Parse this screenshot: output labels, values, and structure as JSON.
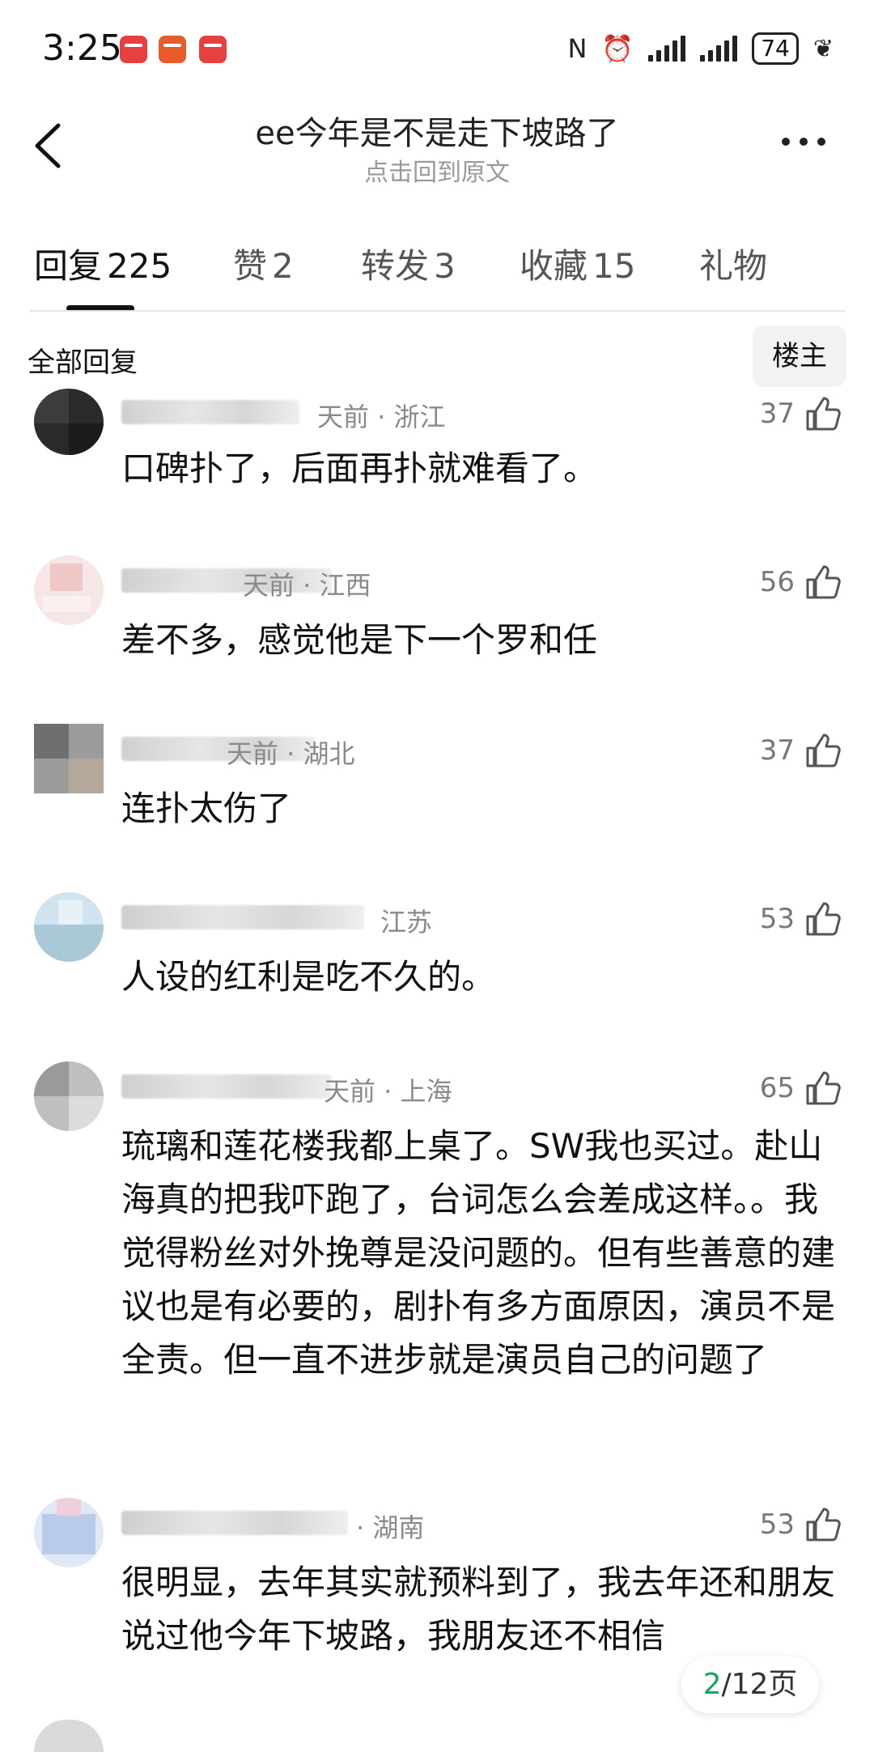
{
  "status_bar": {
    "time": "3:25",
    "battery": "74",
    "nfc_icon": "N",
    "alarm_icon": "⏰",
    "leaf_icon": "❦"
  },
  "header": {
    "title": "ee今年是不是走下坡路了",
    "subtitle": "点击回到原文"
  },
  "tabs": [
    {
      "label": "回复",
      "count": "225"
    },
    {
      "label": "赞",
      "count": "2"
    },
    {
      "label": "转发",
      "count": "3"
    },
    {
      "label": "收藏",
      "count": "15"
    },
    {
      "label": "礼物",
      "count": ""
    }
  ],
  "section": {
    "title": "全部回复",
    "owner_button": "楼主"
  },
  "comments": [
    {
      "meta": "天前 · 浙江",
      "likes": "37",
      "text": "口碑扑了，后面再扑就难看了。"
    },
    {
      "meta": "天前 · 江西",
      "likes": "56",
      "text": "差不多，感觉他是下一个罗和任"
    },
    {
      "meta": "天前 · 湖北",
      "likes": "37",
      "text": "连扑太伤了"
    },
    {
      "meta": "江苏",
      "likes": "53",
      "text": "人设的红利是吃不久的。"
    },
    {
      "meta": "天前 · 上海",
      "likes": "65",
      "text": "琉璃和莲花楼我都上桌了。SW我也买过。赴山海真的把我吓跑了，台词怎么会差成这样。。我觉得粉丝对外挽尊是没问题的。但有些善意的建议也是有必要的，剧扑有多方面原因，演员不是全责。但一直不进步就是演员自己的问题了"
    },
    {
      "meta": "· 湖南",
      "likes": "53",
      "text": "很明显，去年其实就预料到了，我去年还和朋友说过他今年下坡路，我朋友还不相信"
    }
  ],
  "pager": {
    "current": "2",
    "total": "/12页"
  },
  "colors": {
    "accent": "#1aa260",
    "meta": "#8a8a8a",
    "text": "#111111"
  }
}
